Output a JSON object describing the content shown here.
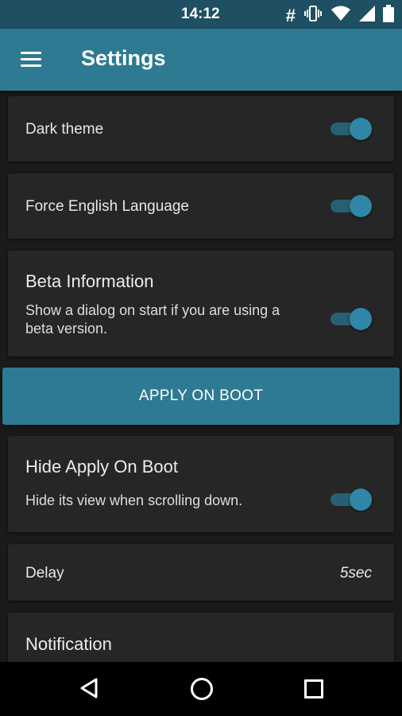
{
  "status_bar": {
    "time": "14:12",
    "icons": [
      "hash-icon",
      "vibrate-icon",
      "wifi-icon",
      "signal-icon",
      "battery-icon"
    ]
  },
  "app_bar": {
    "title": "Settings",
    "menu_icon": "hamburger-menu-icon"
  },
  "settings": {
    "dark_theme": {
      "label": "Dark theme",
      "enabled": true
    },
    "force_english": {
      "label": "Force English Language",
      "enabled": true
    },
    "beta_info": {
      "title": "Beta Information",
      "description": "Show a dialog on start if you are using a beta version.",
      "enabled": true
    },
    "apply_on_boot_button": "APPLY ON BOOT",
    "hide_apply_on_boot": {
      "title": "Hide Apply On Boot",
      "description": "Hide its view when scrolling down.",
      "enabled": true
    },
    "delay": {
      "label": "Delay",
      "value": "5sec"
    },
    "notification": {
      "title": "Notification"
    }
  },
  "colors": {
    "primary": "#2e7a92",
    "status_bar": "#1e4f62",
    "background": "#1a1a1a",
    "card": "#262626",
    "switch_thumb": "#2f86a6",
    "switch_track": "#2a5f72"
  },
  "nav_bar": {
    "icons": [
      "back-icon",
      "home-icon",
      "recents-icon"
    ]
  }
}
